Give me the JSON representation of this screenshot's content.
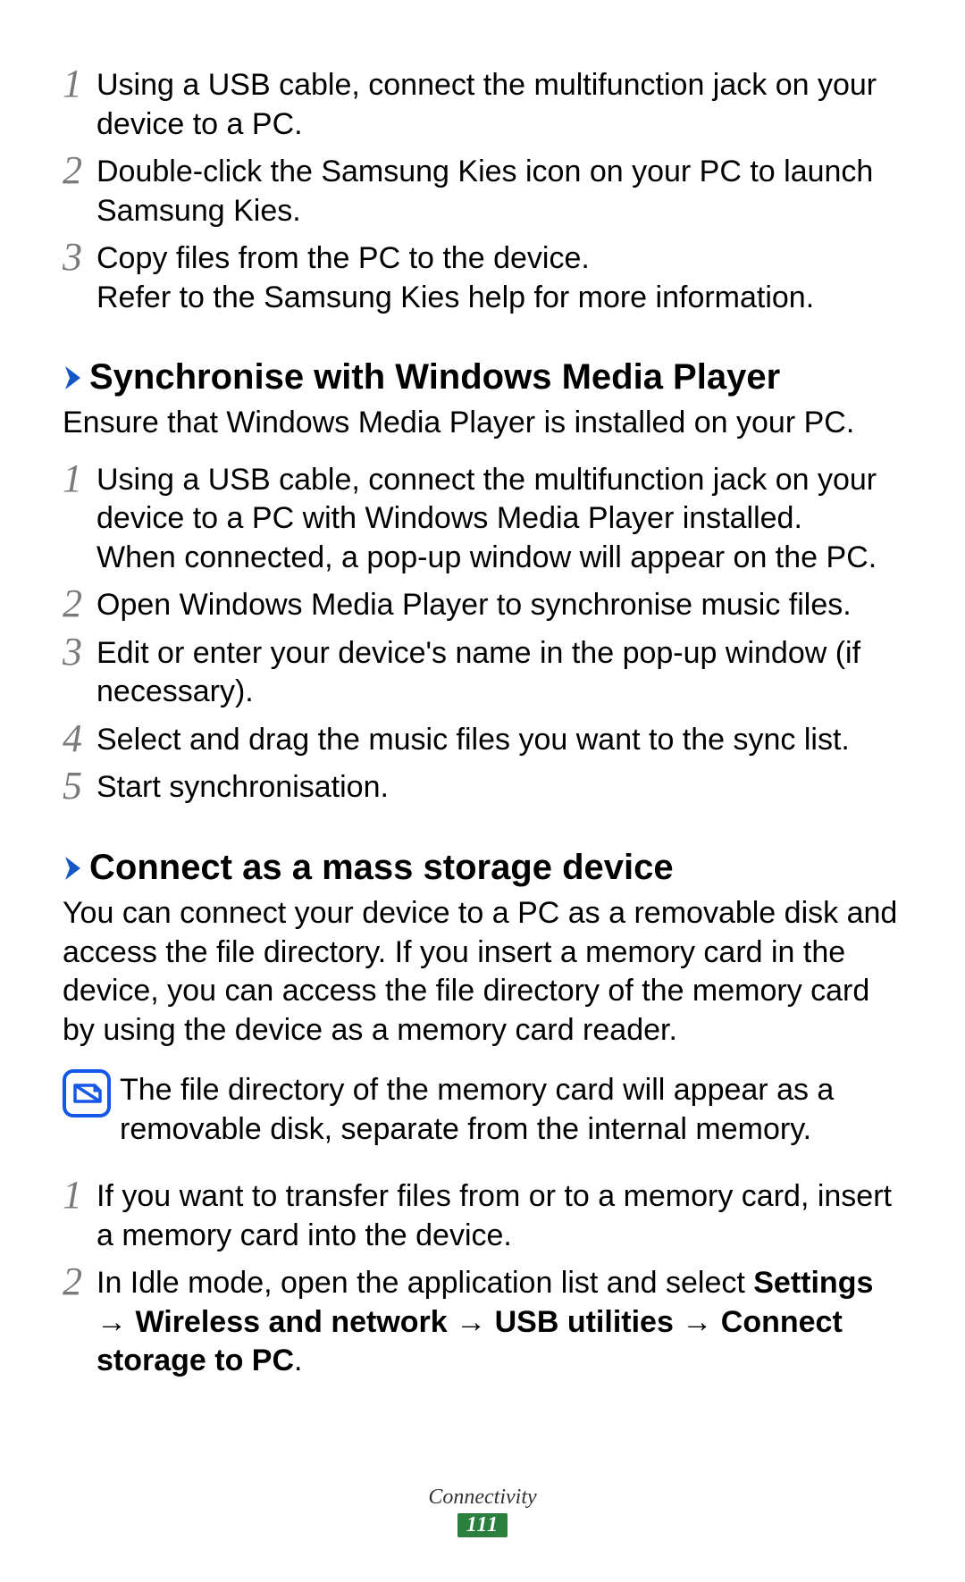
{
  "top_steps": [
    {
      "num": "1",
      "text": "Using a USB cable, connect the multifunction jack on your device to a PC."
    },
    {
      "num": "2",
      "text": "Double-click the Samsung Kies icon on your PC to launch Samsung Kies."
    },
    {
      "num": "3",
      "text": "Copy files from the PC to the device.\nRefer to the Samsung Kies help for more information."
    }
  ],
  "section1": {
    "title": "Synchronise with Windows Media Player",
    "intro": "Ensure that Windows Media Player is installed on your PC.",
    "steps": [
      {
        "num": "1",
        "text": "Using a USB cable, connect the multifunction jack on your device to a PC with Windows Media Player installed.\nWhen connected, a pop-up window will appear on the PC."
      },
      {
        "num": "2",
        "text": "Open Windows Media Player to synchronise music files."
      },
      {
        "num": "3",
        "text": "Edit or enter your device's name in the pop-up window (if necessary)."
      },
      {
        "num": "4",
        "text": "Select and drag the music files you want to the sync list."
      },
      {
        "num": "5",
        "text": "Start synchronisation."
      }
    ]
  },
  "section2": {
    "title": "Connect as a mass storage device",
    "intro": "You can connect your device to a PC as a removable disk and access the file directory. If you insert a memory card in the device, you can access the file directory of the memory card by using the device as a memory card reader.",
    "note": "The file directory of the memory card will appear as a removable disk, separate from the internal memory.",
    "steps": [
      {
        "num": "1",
        "text": "If you want to transfer files from or to a memory card, insert a memory card into the device."
      }
    ],
    "step2": {
      "num": "2",
      "prefix": "In Idle mode, open the application list and select ",
      "b1": "Settings",
      "arrow1": " → ",
      "b2": "Wireless and network",
      "arrow2": " → ",
      "b3": "USB utilities",
      "arrow3": " → ",
      "b4": "Connect storage to PC",
      "suffix": "."
    }
  },
  "footer": {
    "label": "Connectivity",
    "page": "111"
  }
}
